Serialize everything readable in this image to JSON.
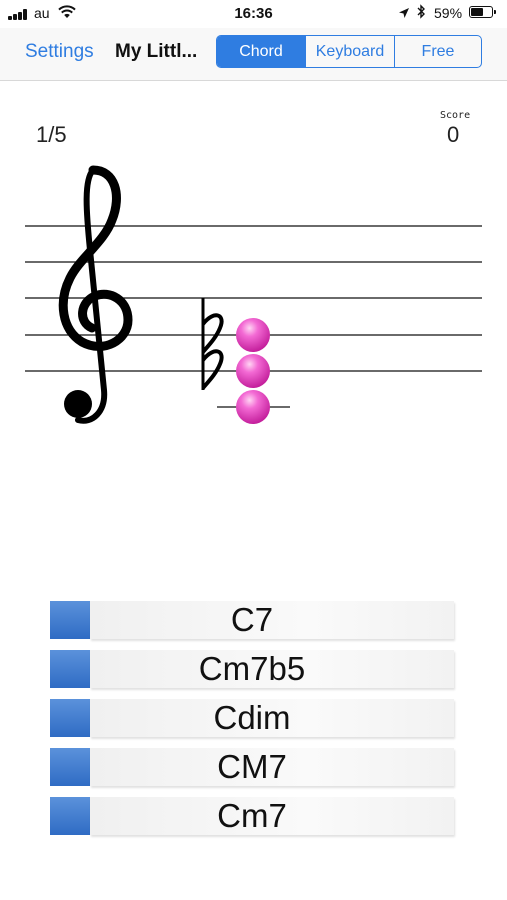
{
  "status_bar": {
    "carrier": "au",
    "time": "16:36",
    "battery_percent": "59%",
    "battery_level": 0.59,
    "icons": [
      "signal-bars-icon",
      "wifi-icon",
      "location-arrow-icon",
      "bluetooth-icon",
      "battery-icon"
    ]
  },
  "navbar": {
    "back_label": "Settings",
    "title": "My Littl...",
    "segments": [
      {
        "label": "Chord",
        "selected": true
      },
      {
        "label": "Keyboard",
        "selected": false
      },
      {
        "label": "Free",
        "selected": false
      }
    ],
    "accent_color": "#2f7de1"
  },
  "quiz": {
    "progress": "1/5",
    "score_label": "Score",
    "score_value": "0",
    "clef": "treble-clef-icon",
    "accidental": "flat-icon",
    "note_color": "#e23fbf"
  },
  "answers": [
    {
      "label": "C7"
    },
    {
      "label": "Cm7b5"
    },
    {
      "label": "Cdim"
    },
    {
      "label": "CM7"
    },
    {
      "label": "Cm7"
    }
  ],
  "colors": {
    "answer_marker": "#3a78cf"
  }
}
